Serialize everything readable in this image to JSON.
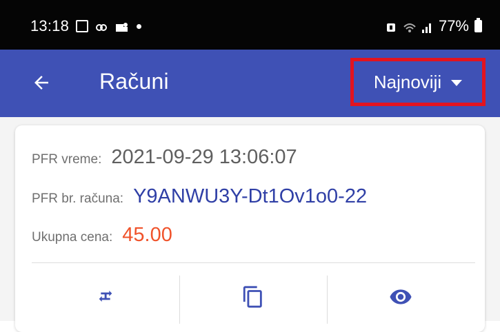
{
  "status_bar": {
    "time": "13:18",
    "battery_text": "77%",
    "left_icons": [
      "gallery-icon",
      "link-icon",
      "teams-icon",
      "dot-icon"
    ],
    "right_icons": [
      "alarm-icon",
      "wifi-calling-icon",
      "signal-icon",
      "battery-icon"
    ]
  },
  "app_bar": {
    "title": "Računi",
    "back_icon": "arrow-left-icon",
    "sort": {
      "selected": "Najnoviji",
      "caret_icon": "caret-down-icon"
    },
    "colors": {
      "background": "#3f51b5",
      "highlight_border": "#e3141f"
    }
  },
  "invoice": {
    "pfr_time_label": "PFR vreme:",
    "pfr_time_value": "2021-09-29 13:06:07",
    "pfr_number_label": "PFR br. računa:",
    "pfr_number_value": "Y9ANWU3Y-Dt1Ov1o0-22",
    "total_label": "Ukupna cena:",
    "total_value": "45.00",
    "colors": {
      "number": "#2f3fa6",
      "price": "#f0532b"
    },
    "actions": [
      {
        "icon": "refund-transfer-icon"
      },
      {
        "icon": "copy-icon"
      },
      {
        "icon": "view-eye-icon"
      }
    ]
  }
}
